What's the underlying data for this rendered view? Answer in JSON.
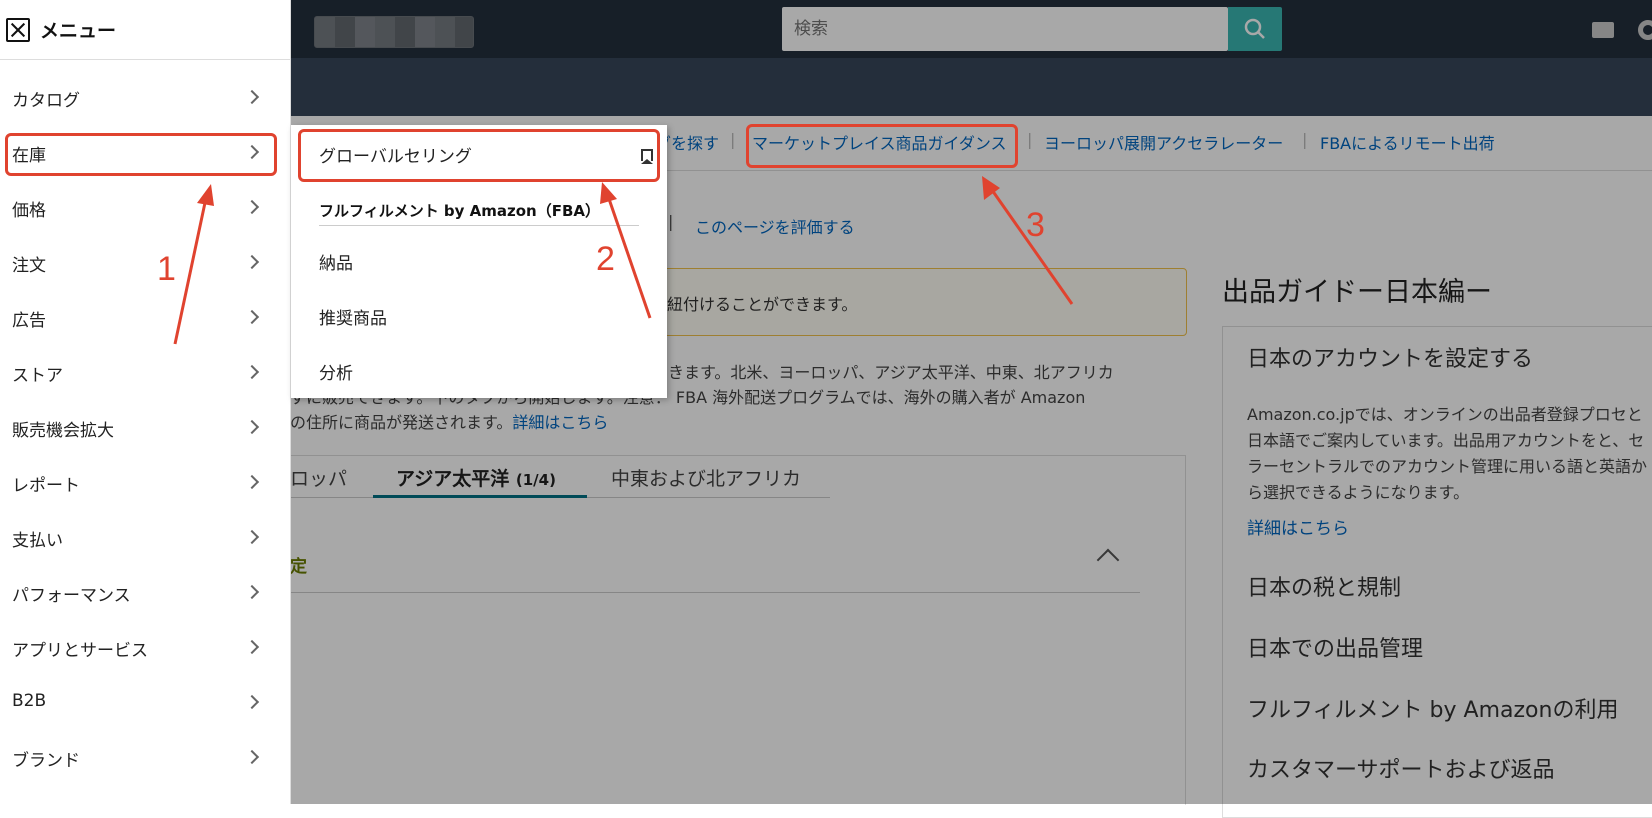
{
  "header": {
    "search_placeholder": "検索"
  },
  "links": [
    "グを探す",
    "マーケットプレイス商品ガイダンス",
    "ヨーロッパ展開アクセラレーター",
    "FBAによるリモート出荷"
  ],
  "rate_page": "このページを評価する",
  "alert_text": "に紐付けることができます。",
  "body_text": {
    "line1": "できます。北米、ヨーロッパ、アジア太平洋、中東、北アフリカ",
    "line2": "ずに販売できます。下のタブから開始します。注意： FBA 海外配送プログラムでは、海外の購入者が Amazon",
    "line3": "の住所に商品が発送されます。",
    "detail_link": "詳細はこちら"
  },
  "tabs": [
    "ロッパ",
    "アジア太平洋",
    "(1/4)",
    "中東および北アフリカ"
  ],
  "section_title": "定",
  "guide": {
    "title": "出品ガイドー日本編ー",
    "items": [
      "日本のアカウントを設定する",
      "日本の税と規制",
      "日本での出品管理",
      "フルフィルメント by Amazonの利用",
      "カスタマーサポートおよび返品"
    ],
    "paragraph": "Amazon.co.jpでは、オンラインの出品者登録プロセと日本語でご案内しています。出品用アカウントをと、セラーセントラルでのアカウント管理に用いる語と英語から選択できるようになります。",
    "link": "詳細はこちら"
  },
  "menu": {
    "title": "メニュー",
    "items": [
      "カタログ",
      "在庫",
      "価格",
      "注文",
      "広告",
      "ストア",
      "販売機会拡大",
      "レポート",
      "支払い",
      "パフォーマンス",
      "アプリとサービス",
      "B2B",
      "ブランド"
    ]
  },
  "submenu": {
    "global_selling": "グローバルセリング",
    "fba_header": "フルフィルメント by Amazon（FBA）",
    "items": [
      "納品",
      "推奨商品",
      "分析"
    ]
  },
  "annotations": {
    "step1": "1",
    "step2": "2",
    "step3": "3",
    "color": "#e0432f"
  },
  "colors": {
    "topbar": "#232f3e",
    "nav2": "#37475a",
    "link": "#0066c0"
  }
}
